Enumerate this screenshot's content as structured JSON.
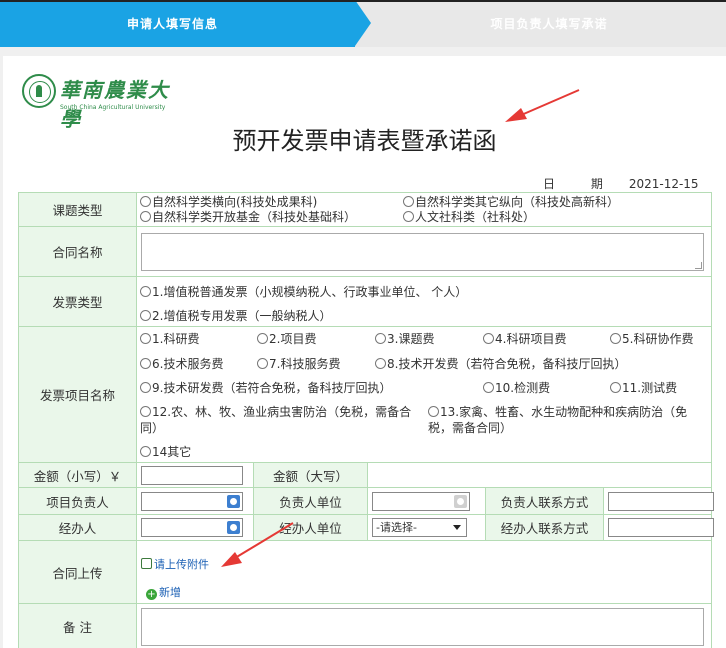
{
  "steps": {
    "step1": "申请人填写信息",
    "step2": "项目负责人填写承诺"
  },
  "logo": {
    "cn": "華南農業大學",
    "en": "South China Agricultural University"
  },
  "title": "预开发票申请表暨承诺函",
  "date": {
    "label": "日  期",
    "value": "2021-12-15"
  },
  "rows": {
    "topic_type": {
      "label": "课题类型",
      "options": [
        "自然科学类横向(科技处成果科)",
        "自然科学类其它纵向（科技处高新科）",
        "自然科学类开放基金（科技处基础科）",
        "人文社科类（社科处）"
      ]
    },
    "contract_name": {
      "label": "合同名称"
    },
    "invoice_type": {
      "label": "发票类型",
      "options": [
        "1.增值税普通发票（小规模纳税人、行政事业单位、 个人）",
        "2.增值税专用发票（一般纳税人）"
      ]
    },
    "invoice_item": {
      "label": "发票项目名称",
      "options": [
        "1.科研费",
        "2.项目费",
        "3.课题费",
        "4.科研项目费",
        "5.科研协作费",
        "6.技术服务费",
        "7.科技服务费",
        "8.技术开发费（若符合免税，备科技厅回执）",
        "9.技术研发费（若符合免税，备科技厅回执）",
        "10.检测费",
        "11.测试费",
        "12.农、林、牧、渔业病虫害防治（免税，需备合同）",
        "13.家禽、牲畜、水生动物配种和疾病防治（免税，需备合同）",
        "14其它"
      ]
    },
    "amount_small": {
      "label": "金额（小写）￥"
    },
    "amount_big": {
      "label": "金额（大写）"
    },
    "leader": {
      "label": "项目负责人"
    },
    "leader_unit": {
      "label": "负责人单位"
    },
    "leader_contact": {
      "label": "负责人联系方式"
    },
    "handler": {
      "label": "经办人"
    },
    "handler_unit": {
      "label": "经办人单位",
      "select": "-请选择-"
    },
    "handler_contact": {
      "label": "经办人联系方式"
    },
    "contract_upload": {
      "label": "合同上传",
      "upload": "请上传附件",
      "add": "新增"
    },
    "remarks": {
      "label": "备    注"
    }
  },
  "colors": {
    "accent": "#1aa3e4",
    "label_bg": "#eaf7ea",
    "border": "#b5dcb5",
    "logo": "#2f8c4a",
    "annotation": "#e53935"
  }
}
